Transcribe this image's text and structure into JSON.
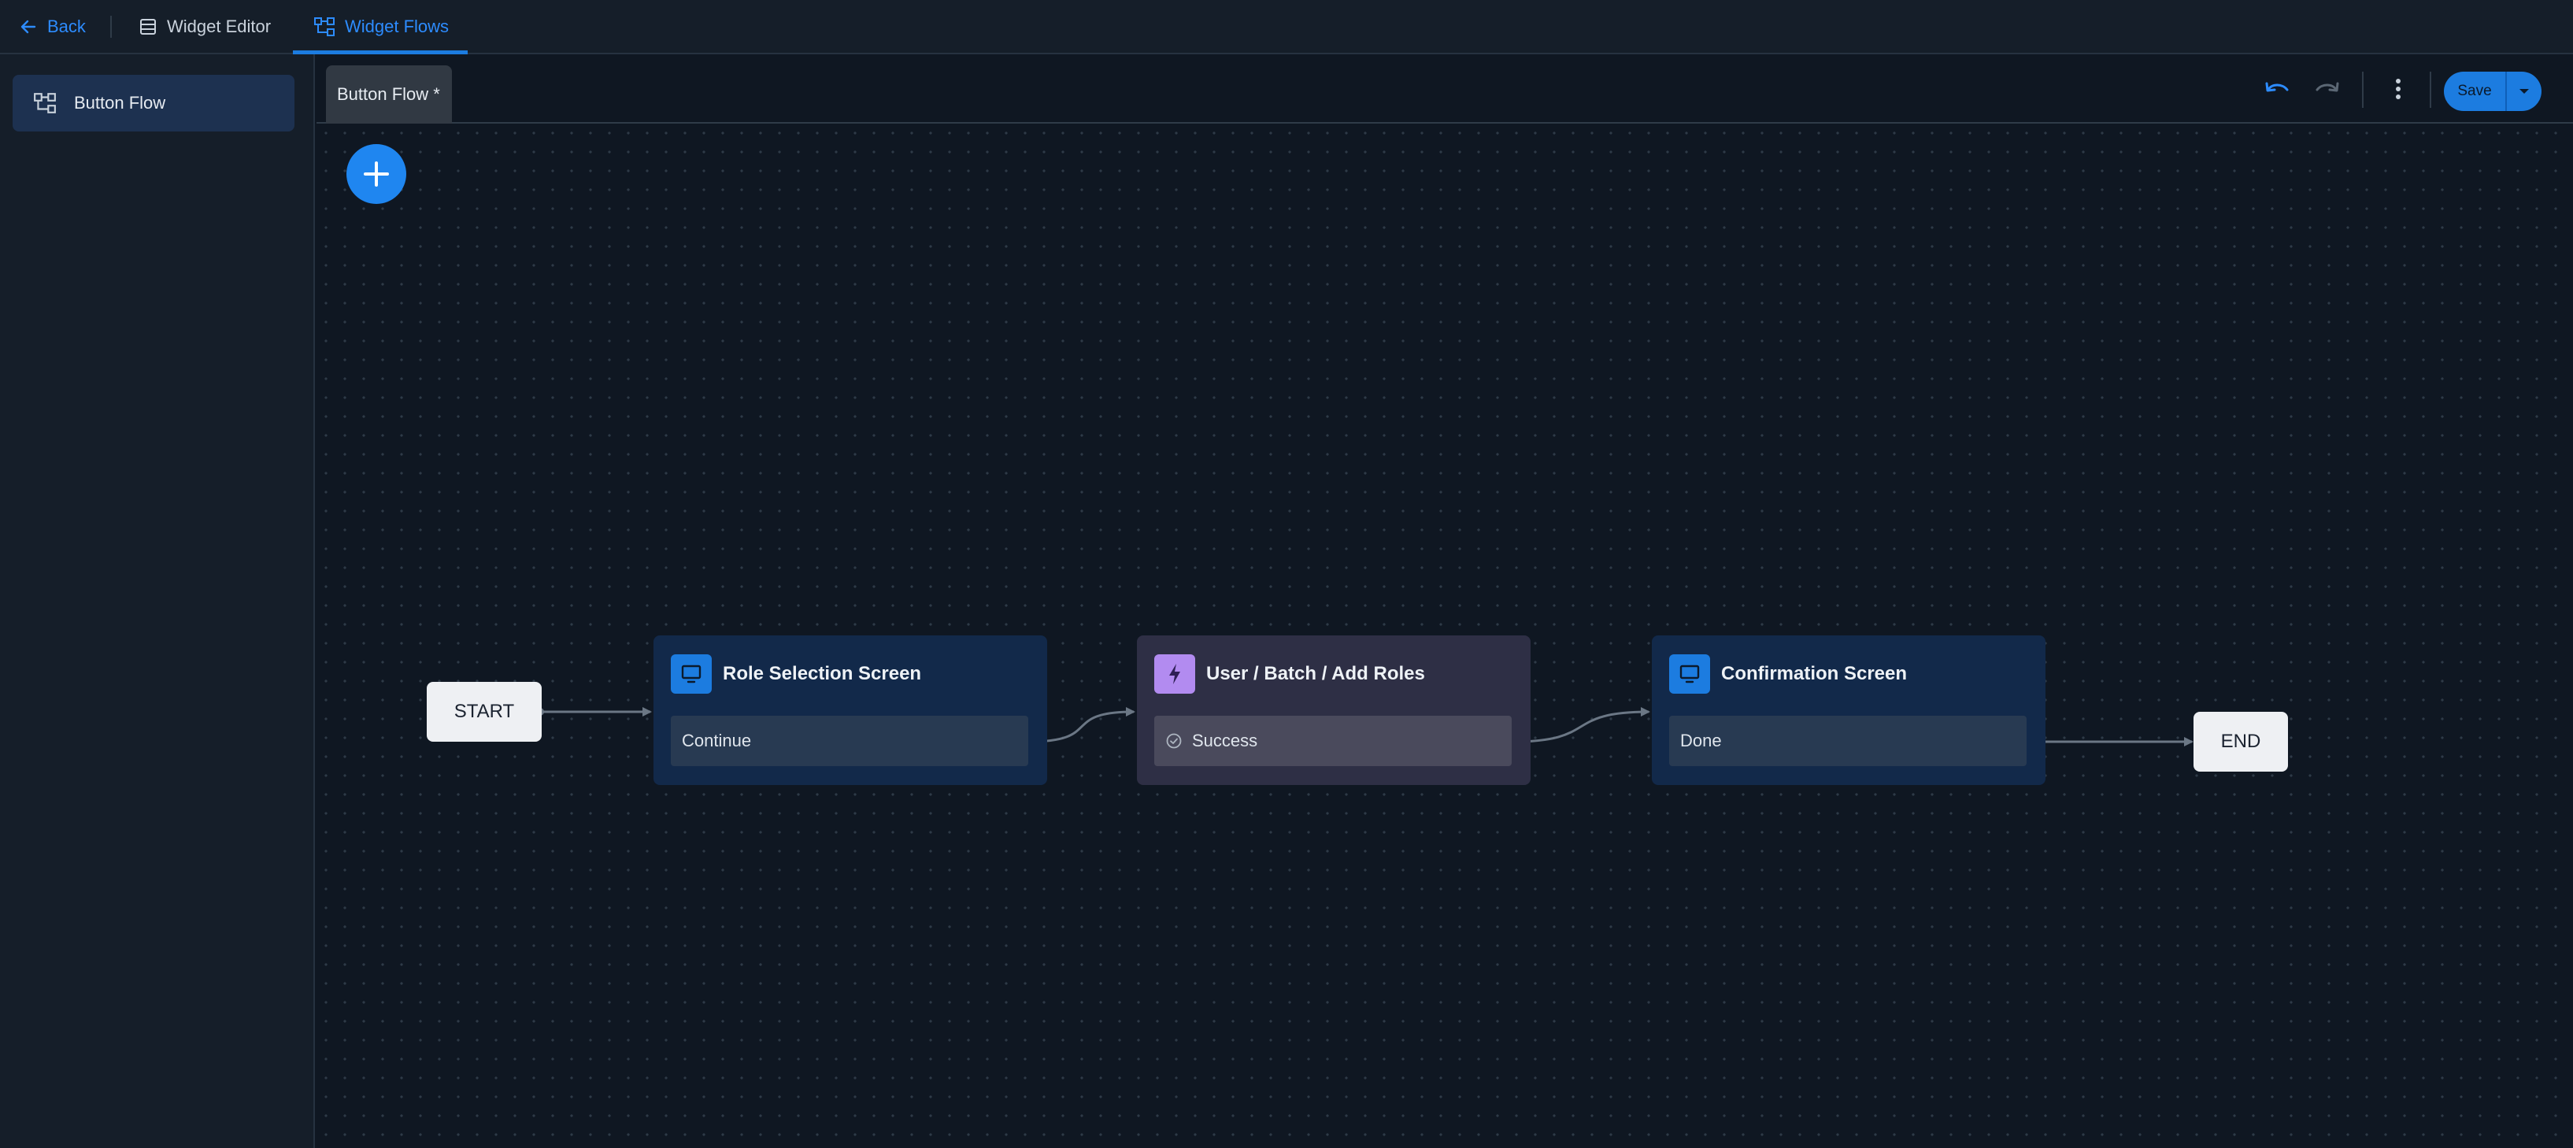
{
  "topbar": {
    "back_label": "Back",
    "editor_label": "Widget Editor",
    "flows_label": "Widget Flows"
  },
  "sidebar": {
    "items": [
      {
        "label": "Button Flow",
        "icon": "flow-icon",
        "selected": true
      }
    ]
  },
  "editor": {
    "tab_label": "Button Flow *",
    "save_label": "Save",
    "accent_color": "#1c7ce0"
  },
  "canvas": {
    "start_label": "START",
    "end_label": "END",
    "nodes": [
      {
        "title": "Role Selection Screen",
        "kind": "screen",
        "icon": "monitor-icon",
        "port": "Continue"
      },
      {
        "title": "User / Batch / Add Roles",
        "kind": "action",
        "icon": "lightning-icon",
        "port": "Success",
        "port_icon": "check-circle-icon"
      },
      {
        "title": "Confirmation Screen",
        "kind": "screen",
        "icon": "monitor-icon",
        "port": "Done"
      }
    ]
  }
}
